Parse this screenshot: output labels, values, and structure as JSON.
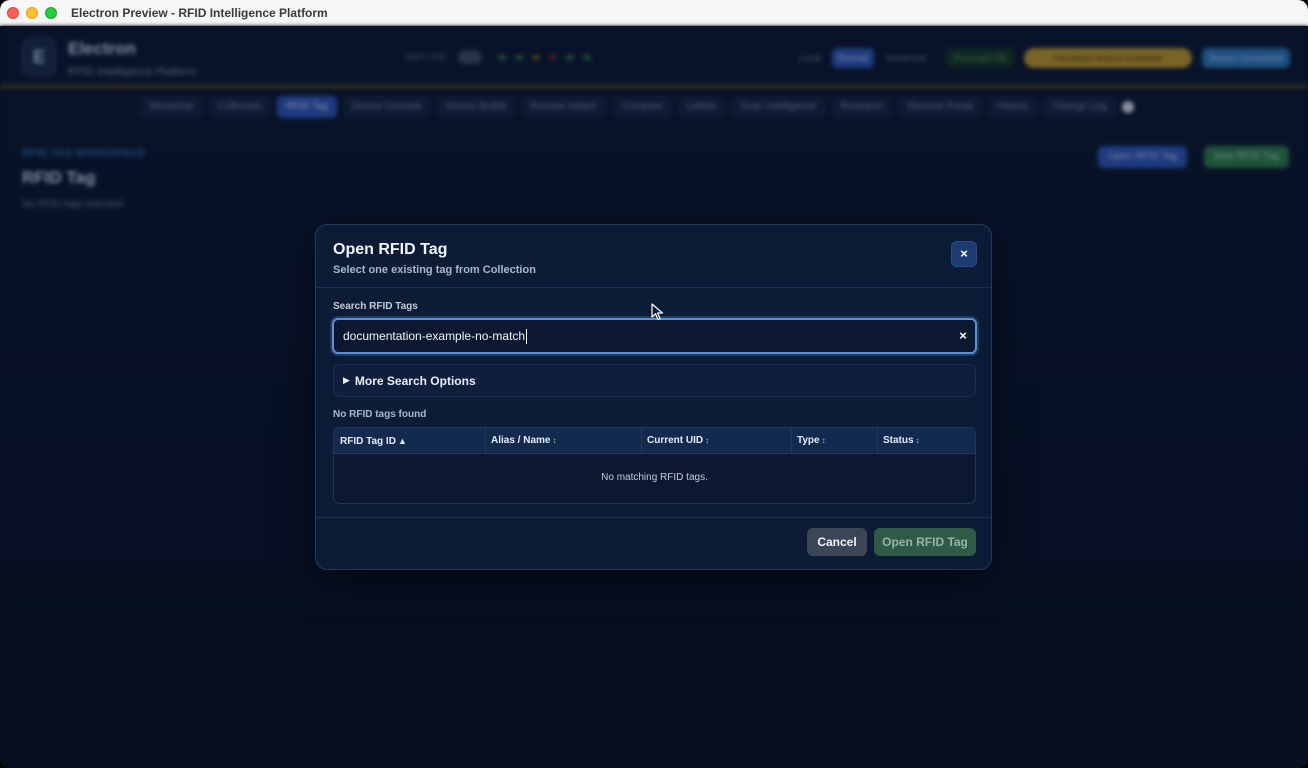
{
  "window": {
    "title": "Electron Preview - RFID Intelligence Platform"
  },
  "app": {
    "brand": "Electron",
    "brand_letter": "E",
    "brand_subtitle": "RFID Intelligence Platform",
    "header": {
      "live_label": "AND LIVE",
      "pills": [
        "Local",
        "Remote",
        "Advanced",
        "Proxmark Ok",
        "Hardware feature available",
        "Device Connected"
      ]
    },
    "nav": [
      "Workshop",
      "Collection",
      "RFID Tag",
      "Device Console",
      "Device Builds",
      "Remote Helper",
      "Compare",
      "Labels",
      "Scan Intelligence",
      "Research",
      "Electron Portal",
      "History",
      "Change Log"
    ],
    "nav_active_index": 2,
    "workspace": {
      "kicker": "RFID TAG WORKSPACE",
      "title": "RFID Tag",
      "subtitle": "No RFID tags selected",
      "buttons": [
        "Open RFID Tag",
        "New RFID Tag"
      ]
    }
  },
  "modal": {
    "title": "Open RFID Tag",
    "subtitle": "Select one existing tag from Collection",
    "close_glyph": "×",
    "search": {
      "label": "Search RFID Tags",
      "value": "documentation-example-no-match",
      "clear_glyph": "×"
    },
    "more_options": {
      "glyph": "▶",
      "label": "More Search Options"
    },
    "status": "No RFID tags found",
    "table": {
      "columns": [
        {
          "label": "RFID Tag ID",
          "sort": "▲"
        },
        {
          "label": "Alias / Name",
          "sort": "↕"
        },
        {
          "label": "Current UID",
          "sort": "↕"
        },
        {
          "label": "Type",
          "sort": "↕"
        },
        {
          "label": "Status",
          "sort": "↕"
        }
      ],
      "empty_message": "No matching RFID tags."
    },
    "buttons": {
      "cancel": "Cancel",
      "open": "Open RFID Tag"
    }
  },
  "colors": {
    "accent_blue": "#5b8fd6",
    "open_button": "#2f5a45",
    "cancel_button": "#3b4558",
    "modal_bg": "#0d1c36"
  }
}
